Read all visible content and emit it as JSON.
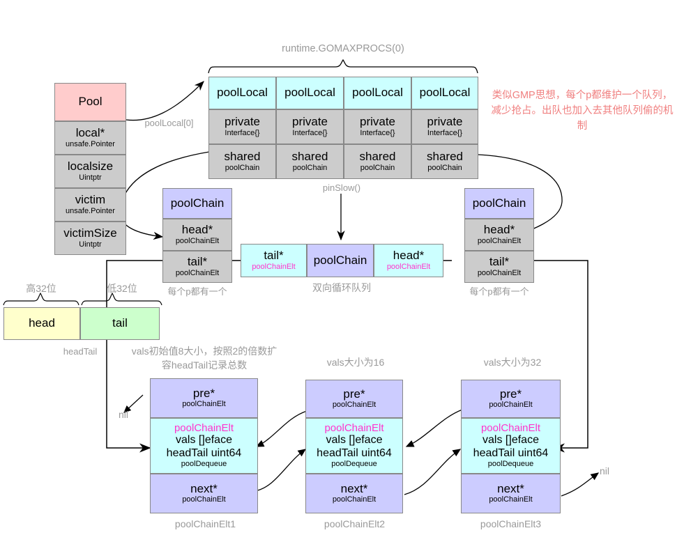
{
  "colors": {
    "pool_header": "#ffcccc",
    "struct_body": "#cccccc",
    "poollocal_header": "#ccffff",
    "poolchain_header": "#ccccff",
    "dequeue_body": "#ccffff",
    "magenta": "#ff33cc",
    "note_gray": "#999999",
    "note_red": "#f08080",
    "head_box": "#ffffcc",
    "tail_box": "#ccffcc"
  },
  "pool_struct": {
    "title": "Pool",
    "fields": [
      {
        "name": "local*",
        "type": "unsafe.Pointer"
      },
      {
        "name": "localsize",
        "type": "Uintptr"
      },
      {
        "name": "victim",
        "type": "unsafe.Pointer"
      },
      {
        "name": "victimSize",
        "type": "Uintptr"
      }
    ]
  },
  "pool_local": {
    "bracket_label": "runtime.GOMAXPROCS(0)",
    "below_label": "pinSlow()",
    "pointer_label": "poolLocal[0]",
    "columns": [
      {
        "title": "poolLocal",
        "fields": [
          {
            "name": "private",
            "type": "Interface{}"
          },
          {
            "name": "shared",
            "type": "poolChain"
          }
        ]
      },
      {
        "title": "poolLocal",
        "fields": [
          {
            "name": "private",
            "type": "Interface{}"
          },
          {
            "name": "shared",
            "type": "poolChain"
          }
        ]
      },
      {
        "title": "poolLocal",
        "fields": [
          {
            "name": "private",
            "type": "Interface{}"
          },
          {
            "name": "shared",
            "type": "poolChain"
          }
        ]
      },
      {
        "title": "poolLocal",
        "fields": [
          {
            "name": "private",
            "type": "Interface{}"
          },
          {
            "name": "shared",
            "type": "poolChain"
          }
        ]
      }
    ]
  },
  "red_note": "类似GMP思想，每个p都维护一个队列，减少抢占。出队也加入去其他队列偷的机制",
  "pool_chain_left": {
    "title": "poolChain",
    "fields": [
      {
        "name": "head*",
        "type": "poolChainElt"
      },
      {
        "name": "tail*",
        "type": "poolChainElt"
      }
    ],
    "caption": "每个p都有一个"
  },
  "pool_chain_right": {
    "title": "poolChain",
    "fields": [
      {
        "name": "head*",
        "type": "poolChainElt"
      },
      {
        "name": "tail*",
        "type": "poolChainElt"
      }
    ],
    "caption": "每个p都有一个"
  },
  "pool_chain_center": {
    "tail_name": "tail*",
    "tail_type": "poolChainElt",
    "title": "poolChain",
    "head_name": "head*",
    "head_type": "poolChainElt",
    "caption": "双向循环队列"
  },
  "head_tail": {
    "high_label": "高32位",
    "low_label": "低32位",
    "head": "head",
    "tail": "tail",
    "caption": "headTail"
  },
  "vals_note": "vals初始值8大小，按照2的倍数扩容headTail记录总数",
  "elts": [
    {
      "pre_name": "pre*",
      "pre_type": "poolChainElt",
      "body_title": "poolChainElt",
      "body_line1": "vals []eface",
      "body_line2": "headTail uint64",
      "body_type": "poolDequeue",
      "next_name": "next*",
      "next_type": "poolChainElt",
      "caption": "poolChainElt1",
      "size_note": ""
    },
    {
      "pre_name": "pre*",
      "pre_type": "poolChainElt",
      "body_title": "poolChainElt",
      "body_line1": "vals []eface",
      "body_line2": "headTail uint64",
      "body_type": "poolDequeue",
      "next_name": "next*",
      "next_type": "poolChainElt",
      "caption": "poolChainElt2",
      "size_note": "vals大小为16"
    },
    {
      "pre_name": "pre*",
      "pre_type": "poolChainElt",
      "body_title": "poolChainElt",
      "body_line1": "vals []eface",
      "body_line2": "headTail uint64",
      "body_type": "poolDequeue",
      "next_name": "next*",
      "next_type": "poolChainElt",
      "caption": "poolChainElt3",
      "size_note": "vals大小为32"
    }
  ],
  "nil_left": "nil",
  "nil_right": "nil"
}
